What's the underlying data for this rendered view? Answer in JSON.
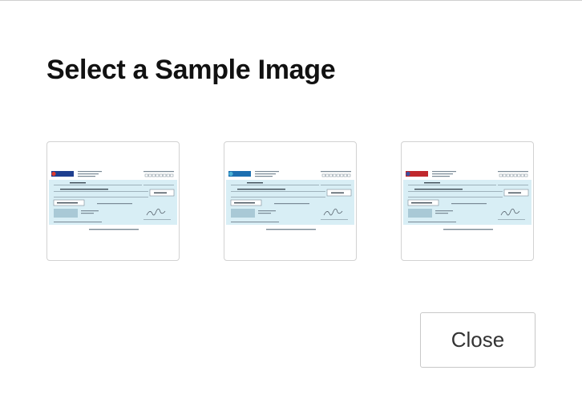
{
  "dialog": {
    "title": "Select a Sample Image",
    "close_label": "Close"
  },
  "samples": [
    {
      "bank_logo_color": "#1f3f8f",
      "logo_accent": "#e03a2f"
    },
    {
      "bank_logo_color": "#1d6fb0",
      "logo_accent": "#4db3d6"
    },
    {
      "bank_logo_color": "#c0282d",
      "logo_accent": "#3a4fa0"
    }
  ],
  "colors": {
    "cheque_band": "#d8eef5",
    "cheque_ink": "#7a8a96",
    "micr_box": "#a9c9d6"
  }
}
